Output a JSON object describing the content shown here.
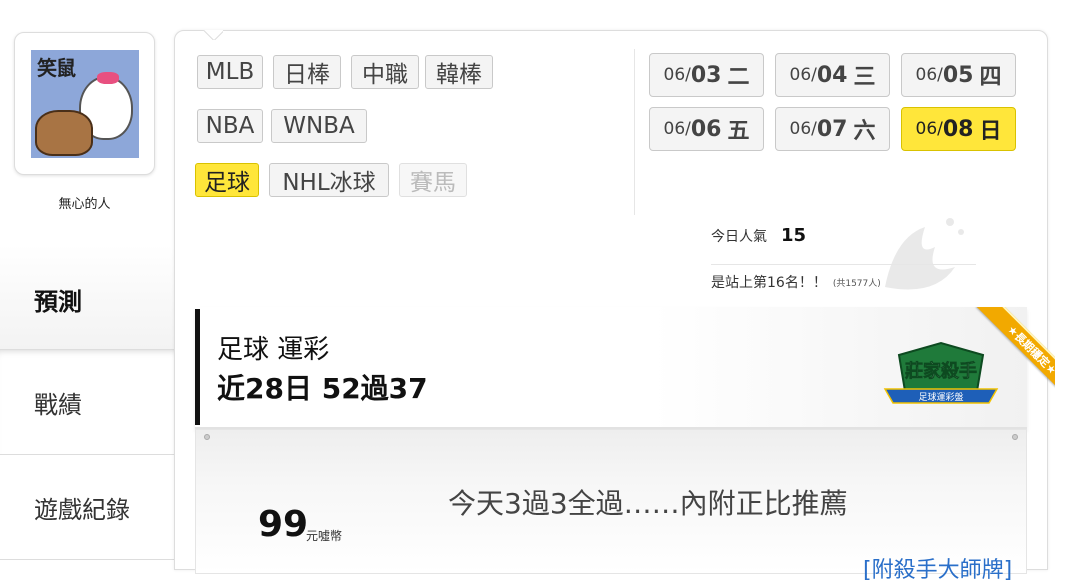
{
  "profile": {
    "avatar_text": "笑鼠",
    "username": "無心的人"
  },
  "side_menu": [
    {
      "label": "預測",
      "active": true
    },
    {
      "label": "戰績",
      "active": false
    },
    {
      "label": "遊戲紀錄",
      "active": false
    }
  ],
  "leagues": [
    {
      "label": "MLB"
    },
    {
      "label": "日棒"
    },
    {
      "label": "中職"
    },
    {
      "label": "韓棒"
    },
    {
      "label": "NBA"
    },
    {
      "label": "WNBA"
    },
    {
      "label": "足球",
      "active": true
    },
    {
      "label": "NHL冰球"
    },
    {
      "label": "賽馬",
      "disabled": true
    }
  ],
  "dates": [
    {
      "m": "06/",
      "d": "03",
      "w": "二"
    },
    {
      "m": "06/",
      "d": "04",
      "w": "三"
    },
    {
      "m": "06/",
      "d": "05",
      "w": "四"
    },
    {
      "m": "06/",
      "d": "06",
      "w": "五"
    },
    {
      "m": "06/",
      "d": "07",
      "w": "六"
    },
    {
      "m": "06/",
      "d": "08",
      "w": "日",
      "active": true
    }
  ],
  "popularity": {
    "label": "今日人氣",
    "count": "15",
    "rank_text": "是站上第16名！！",
    "total_text": "(共1577人)"
  },
  "record": {
    "line1": "足球 運彩",
    "line2": "近28日 52過37",
    "badge_title": "莊家殺手",
    "badge_sub": "足球運彩盤",
    "ribbon": "★長期穩定★"
  },
  "post": {
    "price": "99",
    "price_unit": "元噓幣",
    "title": "今天3過3全過……內附正比推薦",
    "link": "[附殺手大師牌]"
  },
  "colors": {
    "active_yellow": "#ffe63a",
    "link_blue": "#2a6fc9"
  }
}
